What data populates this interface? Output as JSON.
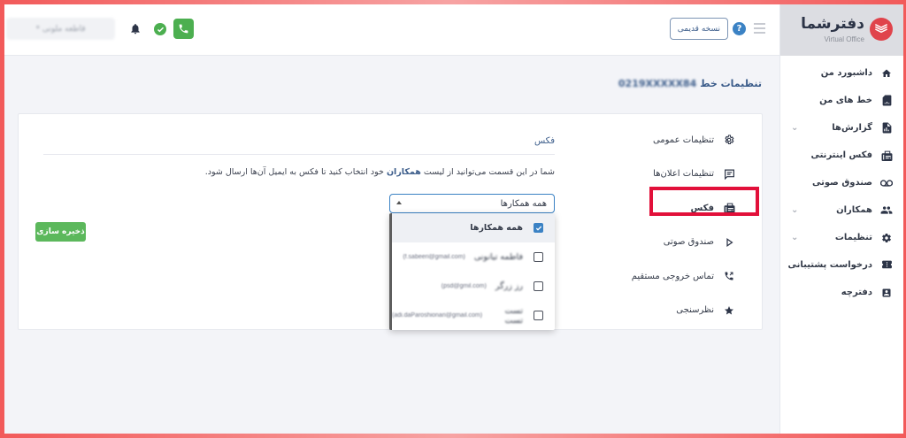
{
  "brand": {
    "name": "دفترشما",
    "subtitle": "Virtual Office",
    "accent": "#e0434b"
  },
  "sidebar": {
    "items": [
      {
        "label": "داشبورد من",
        "icon": "home-icon",
        "has_submenu": false
      },
      {
        "label": "خط های من",
        "icon": "sim-icon",
        "has_submenu": false
      },
      {
        "label": "گزارش‌ها",
        "icon": "report-icon",
        "has_submenu": true
      },
      {
        "label": "فکس اینترنتی",
        "icon": "fax-icon",
        "has_submenu": false
      },
      {
        "label": "صندوق صوتی",
        "icon": "voicemail-icon",
        "has_submenu": false
      },
      {
        "label": "همکاران",
        "icon": "users-icon",
        "has_submenu": true
      },
      {
        "label": "تنظیمات",
        "icon": "gear-icon",
        "has_submenu": true
      },
      {
        "label": "درخواست پشتیبانی",
        "icon": "ticket-icon",
        "has_submenu": false
      },
      {
        "label": "دفترچه",
        "icon": "contacts-icon",
        "has_submenu": false
      }
    ]
  },
  "header": {
    "old_version_label": "نسخه قدیمی",
    "help_symbol": "?",
    "company_name": "قاطعه ملونی *"
  },
  "page": {
    "title_prefix": "تنظیمات خط",
    "line_number": "0219XXXXX84"
  },
  "sub_nav": {
    "items": [
      {
        "label": "تنظیمات عمومی",
        "icon": "gear-icon"
      },
      {
        "label": "تنظیمات اعلان‌ها",
        "icon": "message-icon"
      },
      {
        "label": "فکس",
        "icon": "fax-icon",
        "active": true
      },
      {
        "label": "صندوق صوتی",
        "icon": "play-icon"
      },
      {
        "label": "تماس خروجی مستقیم",
        "icon": "outgoing-call-icon"
      },
      {
        "label": "نظرسنجی",
        "icon": "star-icon"
      }
    ]
  },
  "fax": {
    "section_title": "فکس",
    "desc_before": "شما در این قسمت می‌توانید از لیست",
    "desc_link": "همکاران",
    "desc_after": "خود انتخاب کنید تا فکس به ایمیل آن‌ها ارسال شود.",
    "select_value": "همه همکارها",
    "options": [
      {
        "label": "همه همکارها",
        "email": "",
        "checked": true
      },
      {
        "label": "فاطمه تیانونی",
        "email": "(f.sabeeri@gmail.com)",
        "checked": false
      },
      {
        "label": "رز زرگر",
        "email": "(psd@gmil.com)",
        "checked": false
      },
      {
        "label": "تست تست",
        "email": "(adi.daParoshionari@gmail.com)",
        "checked": false
      }
    ],
    "save_label": "ذخیره سازی"
  },
  "colors": {
    "primary_blue": "#3b82c4",
    "green": "#4caf50",
    "highlight_red": "#e2103a"
  }
}
